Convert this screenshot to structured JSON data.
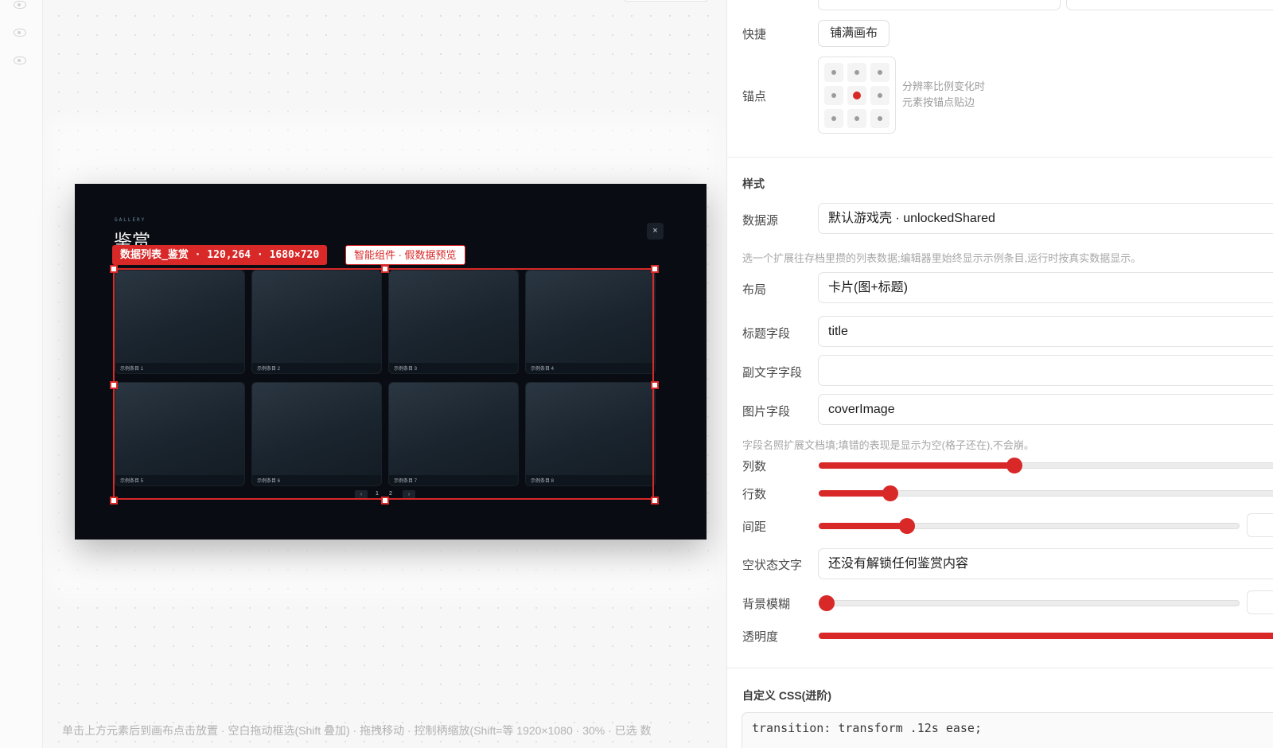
{
  "canvas": {
    "status_text": "单击上方元素后到画布点击放置 · 空白拖动框选(Shift 叠加) · 拖拽移动 · 控制柄缩放(Shift=等    1920×1080  ·  30%  ·  已选  数"
  },
  "gallery": {
    "eyebrow": "GALLERY",
    "title": "鉴赏",
    "close_glyph": "×",
    "selection_label": "数据列表_鉴赏 · 120,264 · 1680×720",
    "smart_label": "智能组件 · 假数据预览",
    "items": [
      {
        "label": "示例条目 1"
      },
      {
        "label": "示例条目 2"
      },
      {
        "label": "示例条目 3"
      },
      {
        "label": "示例条目 4"
      },
      {
        "label": "示例条目 5"
      },
      {
        "label": "示例条目 6"
      },
      {
        "label": "示例条目 7"
      },
      {
        "label": "示例条目 8"
      }
    ],
    "pager": {
      "prev": "‹",
      "next": "›",
      "pages": [
        "1",
        "2"
      ]
    }
  },
  "panel": {
    "quick": {
      "label": "快捷",
      "button": "铺满画布"
    },
    "anchor": {
      "label": "锚点",
      "selected": "center",
      "hint_line1": "分辨率比例变化时",
      "hint_line2": "元素按锚点贴边"
    },
    "style_section": "样式",
    "datasource": {
      "label": "数据源",
      "value": "默认游戏壳 · unlockedShared",
      "hint": "选一个扩展往存档里攒的列表数据;编辑器里始终显示示例条目,运行时按真实数据显示。"
    },
    "layout": {
      "label": "布局",
      "value": "卡片(图+标题)"
    },
    "title_field": {
      "label": "标题字段",
      "value": "title"
    },
    "subtitle_field": {
      "label": "副文字字段",
      "value": ""
    },
    "image_field": {
      "label": "图片字段",
      "value": "coverImage",
      "hint": "字段名照扩展文档填;填错的表现是显示为空(格子还在),不会崩。"
    },
    "columns": {
      "label": "列数",
      "level": 0.41
    },
    "rows": {
      "label": "行数",
      "level": 0.15
    },
    "gap": {
      "label": "间距",
      "level": 0.21
    },
    "empty_text": {
      "label": "空状态文字",
      "value": "还没有解锁任何鉴赏内容"
    },
    "bg_blur": {
      "label": "背景模糊",
      "level": 0.0
    },
    "opacity": {
      "label": "透明度",
      "level": 1.0
    },
    "custom_css": {
      "title": "自定义 CSS(进阶)",
      "code": "transition: transform .12s ease;"
    },
    "accent_color": "#d82828"
  }
}
